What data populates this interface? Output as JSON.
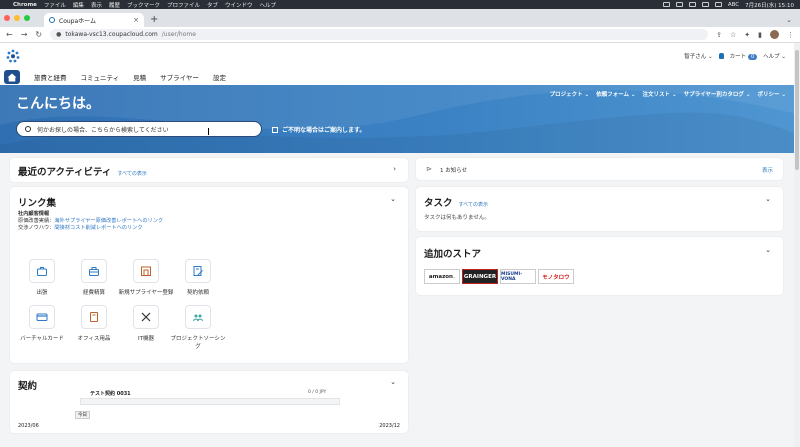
{
  "mac_menu": {
    "app": "Chrome",
    "items": [
      "ファイル",
      "編集",
      "表示",
      "履歴",
      "ブックマーク",
      "プロファイル",
      "タブ",
      "ウインドウ",
      "ヘルプ"
    ],
    "input_source": "ABC",
    "clock": "7月26日(水) 15:10"
  },
  "browser": {
    "tab_title": "Coupaホーム",
    "url_host": "tokawa-vsc13.coupacloud.com",
    "url_path": "/user/home"
  },
  "header": {
    "user": "智子さん",
    "cart_label": "カート",
    "cart_count": "0",
    "help_label": "ヘルプ",
    "nav": [
      "旅費と経費",
      "コミュニティ",
      "見積",
      "サプライヤー",
      "設定"
    ]
  },
  "hero": {
    "greeting": "こんにちは。",
    "search_placeholder": "何かお探しの場合、こちらから検索してください",
    "help_link": "ご不明な場合はご案内します。",
    "menu": [
      "プロジェクト",
      "依頼フォーム",
      "注文リスト",
      "サプライヤー別カタログ",
      "ポリシー"
    ]
  },
  "activity": {
    "title": "最近のアクティビティ",
    "see_all": "すべての表示"
  },
  "links": {
    "title": "リンク集",
    "section_title": "社内顧客情報",
    "rows": [
      {
        "label": "原価改善実績：",
        "link": "海外サプライヤー原価改善レポートへのリンク"
      },
      {
        "label": "交渉ノウハウ：",
        "link": "間接材コスト削減レポートへのリンク"
      }
    ],
    "shortcuts": [
      "出張",
      "経費精算",
      "新規サプライヤー登録",
      "契約依頼",
      "バーチャルカード",
      "オフィス用品",
      "IT機器",
      "プロジェクトソーシング"
    ]
  },
  "contracts": {
    "title": "契約",
    "item_name": "テスト契約 0031",
    "amount": "0 / 0 JPY",
    "today_label": "今日",
    "start": "2023/06",
    "end": "2023/12"
  },
  "notifications": {
    "text": "1 お知らせ",
    "action": "表示"
  },
  "tasks": {
    "title": "タスク",
    "see_all": "すべての表示",
    "empty": "タスクは何もありません。"
  },
  "store": {
    "title": "追加のストア",
    "logos": [
      "amazon",
      "GRAINGER",
      "MISUMI-VONA",
      "モノタロウ"
    ]
  },
  "colors": {
    "hero": "#3b82c4",
    "accent": "#2f78c4",
    "nav_home": "#1e4f8c"
  }
}
